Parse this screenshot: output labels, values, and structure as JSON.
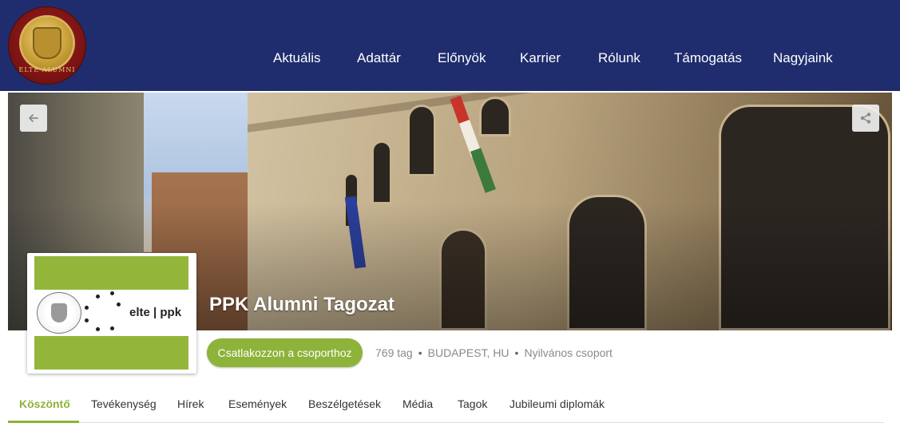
{
  "brand": {
    "logo_text": "ELTE ALUMNI",
    "colors": {
      "header_bg": "#1f2d6e",
      "accent_green": "#8db33a"
    }
  },
  "nav": {
    "items": [
      {
        "label": "Aktuális"
      },
      {
        "label": "Adattár"
      },
      {
        "label": "Előnyök"
      },
      {
        "label": "Karrier"
      },
      {
        "label": "Rólunk"
      },
      {
        "label": "Támogatás"
      },
      {
        "label": "Nagyjaink"
      }
    ]
  },
  "cover": {
    "back_icon": "arrow-left-icon",
    "share_icon": "share-icon"
  },
  "group": {
    "title": "PPK Alumni Tagozat",
    "avatar_text": "elte | ppk",
    "join_label": "Csatlakozzon a csoporthoz",
    "members": "769 tag",
    "location": "BUDAPEST, HU",
    "visibility": "Nyilvános csoport"
  },
  "tabs": [
    {
      "label": "Köszöntő",
      "active": true
    },
    {
      "label": "Tevékenység"
    },
    {
      "label": "Hírek"
    },
    {
      "label": "Események"
    },
    {
      "label": "Beszélgetések"
    },
    {
      "label": "Média"
    },
    {
      "label": "Tagok"
    },
    {
      "label": "Jubileumi diplomák"
    }
  ]
}
